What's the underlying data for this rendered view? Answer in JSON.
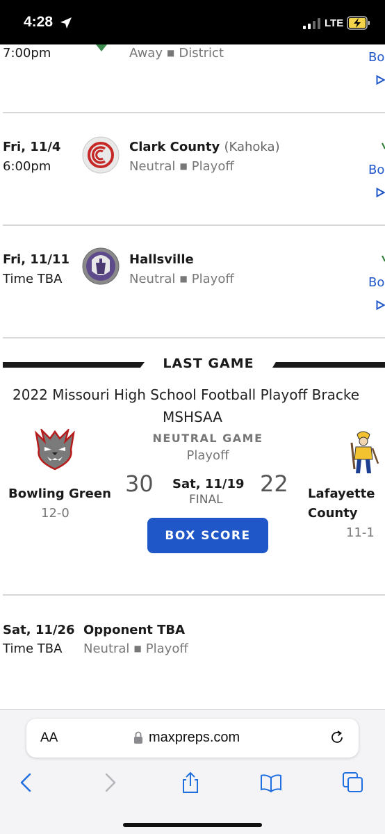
{
  "status_bar": {
    "time": "4:28",
    "network": "LTE"
  },
  "games": [
    {
      "date": "",
      "time": "7:00pm",
      "opponent": "",
      "opponent_location": "",
      "site": "Away",
      "type": "District",
      "box_link": "Bo"
    },
    {
      "date": "Fri, 11/4",
      "time": "6:00pm",
      "opponent": "Clark County",
      "opponent_location": "(Kahoka)",
      "site": "Neutral",
      "type": "Playoff",
      "box_link": "Bo"
    },
    {
      "date": "Fri, 11/11",
      "time": "Time TBA",
      "opponent": "Hallsville",
      "opponent_location": "",
      "site": "Neutral",
      "type": "Playoff",
      "box_link": "Bo"
    }
  ],
  "last_game": {
    "section_title": "LAST GAME",
    "bracket_title": "2022 Missouri High School Football Playoff Bracke",
    "association": "MSHSAA",
    "game_kind": "NEUTRAL GAME",
    "game_type": "Playoff",
    "home": {
      "name": "Bowling Green",
      "record": "12-0",
      "score": "30"
    },
    "away": {
      "name_line1": "Lafayette",
      "name_line2": "County",
      "record": "11-1",
      "score": "22"
    },
    "date": "Sat, 11/19",
    "status": "FINAL",
    "box_score_label": "BOX SCORE"
  },
  "next_game": {
    "date": "Sat, 11/26",
    "time": "Time TBA",
    "opponent": "Opponent TBA",
    "site": "Neutral",
    "type": "Playoff"
  },
  "browser": {
    "aa_label": "AA",
    "url": "maxpreps.com"
  },
  "colors": {
    "accent": "#1f56c8",
    "text": "#1a1a1a",
    "muted": "#777777"
  }
}
